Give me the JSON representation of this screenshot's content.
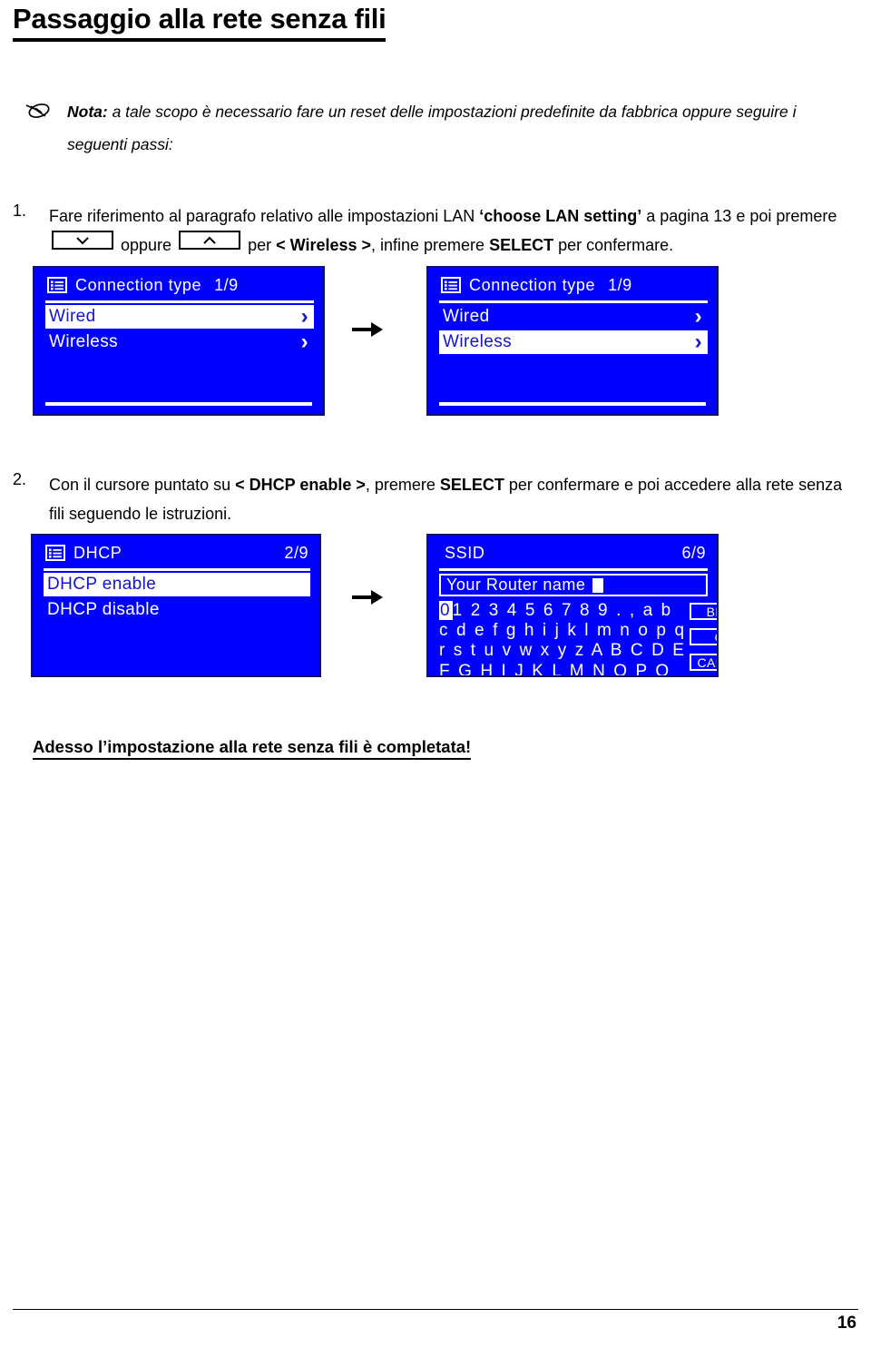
{
  "document": {
    "title": "Passaggio alla rete senza fili",
    "note": {
      "icon": "pen-note-icon",
      "label": "Nota:",
      "text": " a tale scopo è necessario fare un reset delle impostazioni predefinite da fabbrica oppure seguire i seguenti passi:"
    },
    "closing": "Adesso l’impostazione alla rete senza fili è completata!",
    "footer": {
      "page_number": "16"
    }
  },
  "steps": [
    {
      "number": "1.",
      "text_part_1": "Fare riferimento al paragrafo relativo alle impostazioni LAN ",
      "bold_1": "‘choose LAN setting’",
      "text_part_2": " a pagina 13 e poi premere ",
      "key_down": "down-chevron-key",
      "text_part_3": " oppure ",
      "key_up": "up-chevron-key",
      "text_part_4": " per ",
      "bold_2": "< Wireless >",
      "text_part_5": ", infine premere ",
      "bold_3": "SELECT",
      "text_part_6": " per confermare."
    },
    {
      "number": "2.",
      "text_part_1": "Con il cursore puntato su ",
      "bold_1": "< DHCP enable >",
      "text_part_2": ", premere ",
      "bold_2": "SELECT",
      "text_part_3": " per confermare e poi accedere alla rete senza fili seguendo le istruzioni."
    }
  ],
  "screens": {
    "connection_before": {
      "icon": "list-menu-icon",
      "title": "Connection  type",
      "page": "1/9",
      "rows": [
        {
          "label": "Wired",
          "chevron": "›",
          "selected": true
        },
        {
          "label": "Wireless",
          "chevron": "›",
          "selected": false
        }
      ]
    },
    "connection_after": {
      "icon": "list-menu-icon",
      "title": "Connection  type",
      "page": "1/9",
      "rows": [
        {
          "label": "Wired",
          "chevron": "›",
          "selected": false
        },
        {
          "label": "Wireless",
          "chevron": "›",
          "selected": true
        }
      ]
    },
    "dhcp": {
      "icon": "list-menu-icon",
      "title": "DHCP",
      "page": "2/9",
      "rows": [
        {
          "label": "DHCP  enable",
          "chevron": "",
          "selected": true
        },
        {
          "label": "DHCP  disable",
          "chevron": "",
          "selected": false
        }
      ]
    },
    "ssid": {
      "title": "SSID",
      "page": "6/9",
      "input_value": "Your  Router  name",
      "keyboard_rows": [
        {
          "highlight": "0",
          "rest": "1 2 3 4 5 6 7 8 9 . , a b"
        },
        {
          "highlight": "",
          "rest": "c d e f g h i j k l m n o p q"
        },
        {
          "highlight": "",
          "rest": "r s t u v w x y z A B C D E"
        },
        {
          "highlight": "",
          "rest": "F G H I J K L M N O P Q"
        }
      ],
      "buttons": [
        "BKSP",
        "OK",
        "CANCEL"
      ]
    }
  },
  "colors": {
    "lcd_background": "#0000ff",
    "lcd_foreground": "#ffffff",
    "lcd_selected_text": "#1414c8",
    "page_text": "#000000"
  },
  "flow": {
    "arrow": "right-arrow-icon"
  }
}
